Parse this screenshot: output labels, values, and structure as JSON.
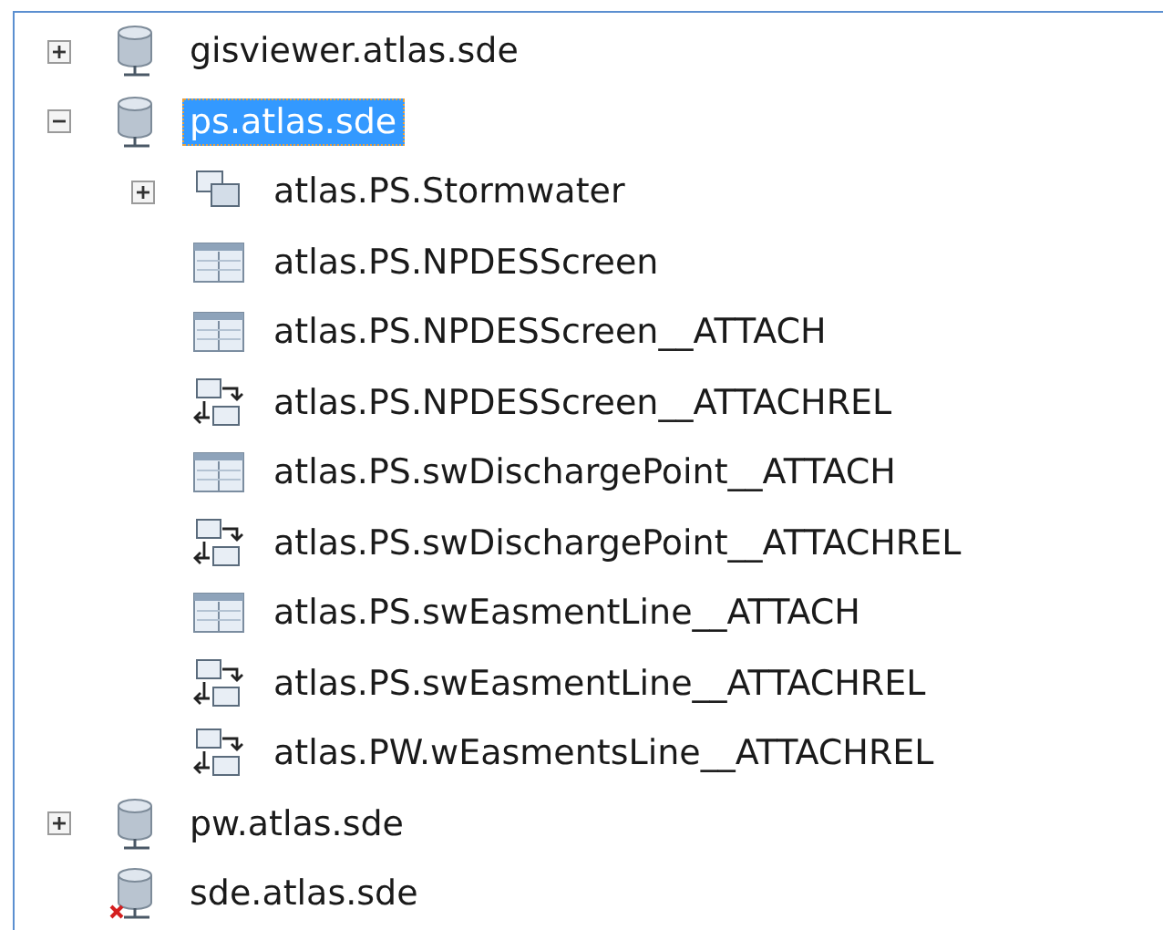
{
  "tree": [
    {
      "label": "gisviewer.atlas.sde",
      "kind": "database",
      "expanded": false,
      "selected": false
    },
    {
      "label": "ps.atlas.sde",
      "kind": "database",
      "expanded": true,
      "selected": true,
      "children": [
        {
          "label": "atlas.PS.Stormwater",
          "kind": "dataset",
          "expanded": false,
          "selected": false
        },
        {
          "label": "atlas.PS.NPDESScreen",
          "kind": "table",
          "selected": false
        },
        {
          "label": "atlas.PS.NPDESScreen__ATTACH",
          "kind": "table",
          "selected": false
        },
        {
          "label": "atlas.PS.NPDESScreen__ATTACHREL",
          "kind": "relationship",
          "selected": false
        },
        {
          "label": "atlas.PS.swDischargePoint__ATTACH",
          "kind": "table",
          "selected": false
        },
        {
          "label": "atlas.PS.swDischargePoint__ATTACHREL",
          "kind": "relationship",
          "selected": false
        },
        {
          "label": "atlas.PS.swEasmentLine__ATTACH",
          "kind": "table",
          "selected": false
        },
        {
          "label": "atlas.PS.swEasmentLine__ATTACHREL",
          "kind": "relationship",
          "selected": false
        },
        {
          "label": "atlas.PW.wEasmentsLine__ATTACHREL",
          "kind": "relationship",
          "selected": false
        }
      ]
    },
    {
      "label": "pw.atlas.sde",
      "kind": "database",
      "expanded": false,
      "selected": false
    },
    {
      "label": "sde.atlas.sde",
      "kind": "database-error",
      "selected": false
    }
  ]
}
